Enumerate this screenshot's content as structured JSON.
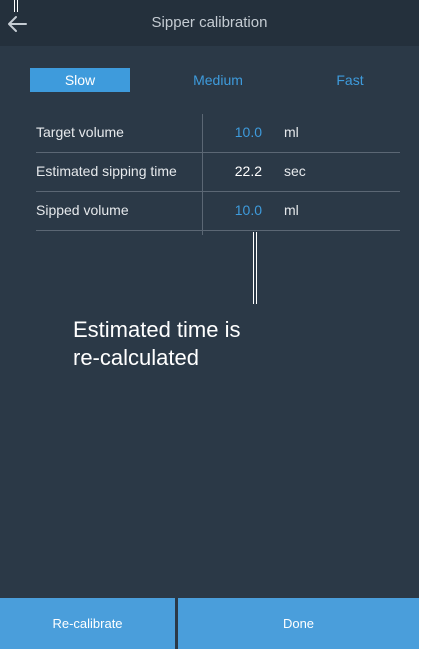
{
  "header": {
    "title": "Sipper calibration",
    "back_icon": "arrow-left-icon"
  },
  "speeds": {
    "selected": "Slow",
    "options": [
      "Slow",
      "Medium",
      "Fast"
    ]
  },
  "rows": [
    {
      "label": "Target volume",
      "value": "10.0",
      "unit": "ml",
      "editable": true
    },
    {
      "label": "Estimated sipping time",
      "value": "22.2",
      "unit": "sec",
      "editable": false
    },
    {
      "label": "Sipped volume",
      "value": "10.0",
      "unit": "ml",
      "editable": true
    }
  ],
  "annotation": {
    "line1": "Estimated time is",
    "line2": "re-calculated"
  },
  "buttons": {
    "recalibrate": "Re-calibrate",
    "done": "Done"
  },
  "colors": {
    "background": "#2b3947",
    "accent": "#3e9bdc",
    "button": "#4a9edb"
  }
}
